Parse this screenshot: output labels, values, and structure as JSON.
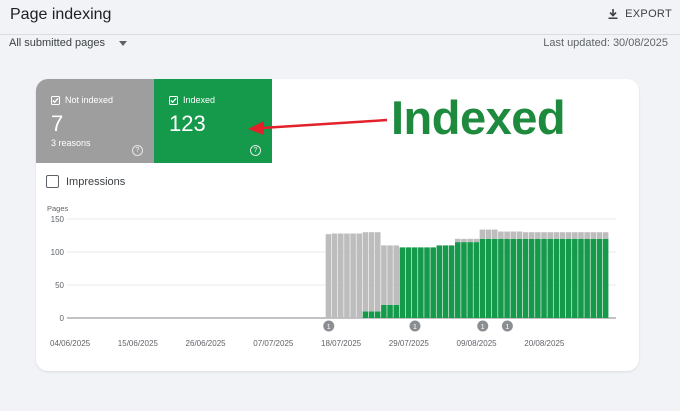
{
  "header": {
    "title": "Page indexing",
    "export_label": "EXPORT",
    "filter_label": "All submitted pages",
    "last_updated": "Last updated: 30/08/2025"
  },
  "tiles": {
    "not_indexed": {
      "label": "Not indexed",
      "value": "7",
      "sub": "3 reasons",
      "help": "?"
    },
    "indexed": {
      "label": "Indexed",
      "value": "123",
      "help": "?"
    }
  },
  "impressions_label": "Impressions",
  "annotation": {
    "text": "Indexed",
    "color": "#1e8a3e"
  },
  "colors": {
    "indexed": "#159a4c",
    "not_indexed": "#bdbdbd",
    "arrow": "#e3212b"
  },
  "chart_data": {
    "type": "bar",
    "ylabel": "Pages",
    "ylim": [
      0,
      150
    ],
    "yticks": [
      0,
      50,
      100,
      150
    ],
    "xtick_labels": [
      "04/06/2025",
      "15/06/2025",
      "26/06/2025",
      "07/07/2025",
      "18/07/2025",
      "29/07/2025",
      "09/08/2025",
      "20/08/2025"
    ],
    "start_date": "2025-06-04",
    "series": [
      {
        "name": "Indexed",
        "values": [
          0,
          0,
          0,
          0,
          0,
          0,
          0,
          0,
          0,
          0,
          0,
          0,
          0,
          0,
          0,
          0,
          0,
          0,
          0,
          0,
          0,
          0,
          0,
          0,
          0,
          0,
          0,
          0,
          0,
          0,
          0,
          0,
          0,
          0,
          0,
          0,
          0,
          0,
          0,
          0,
          0,
          0,
          0,
          0,
          0,
          0,
          0,
          0,
          10,
          10,
          10,
          20,
          20,
          20,
          107,
          107,
          107,
          107,
          107,
          107,
          110,
          110,
          110,
          115,
          115,
          115,
          115,
          120,
          120,
          120,
          120,
          120,
          120,
          120,
          120,
          120,
          120,
          120,
          120,
          120,
          120,
          120,
          120,
          120,
          120,
          120,
          120,
          120
        ]
      },
      {
        "name": "Not indexed",
        "values": [
          0,
          0,
          0,
          0,
          0,
          0,
          0,
          0,
          0,
          0,
          0,
          0,
          0,
          0,
          0,
          0,
          0,
          0,
          0,
          0,
          0,
          0,
          0,
          0,
          0,
          0,
          0,
          0,
          0,
          0,
          0,
          0,
          0,
          0,
          0,
          0,
          0,
          0,
          0,
          0,
          0,
          0,
          127,
          128,
          128,
          128,
          128,
          128,
          120,
          120,
          120,
          90,
          90,
          90,
          0,
          0,
          0,
          0,
          0,
          0,
          0,
          0,
          0,
          5,
          5,
          5,
          5,
          14,
          14,
          14,
          11,
          11,
          11,
          11,
          10,
          10,
          10,
          10,
          10,
          10,
          10,
          10,
          10,
          10,
          10,
          10,
          10,
          10
        ]
      }
    ],
    "annotations": [
      {
        "date": "2025-07-16",
        "label": "1"
      },
      {
        "date": "2025-07-30",
        "label": "1"
      },
      {
        "date": "2025-08-10",
        "label": "1"
      },
      {
        "date": "2025-08-14",
        "label": "1"
      }
    ]
  }
}
